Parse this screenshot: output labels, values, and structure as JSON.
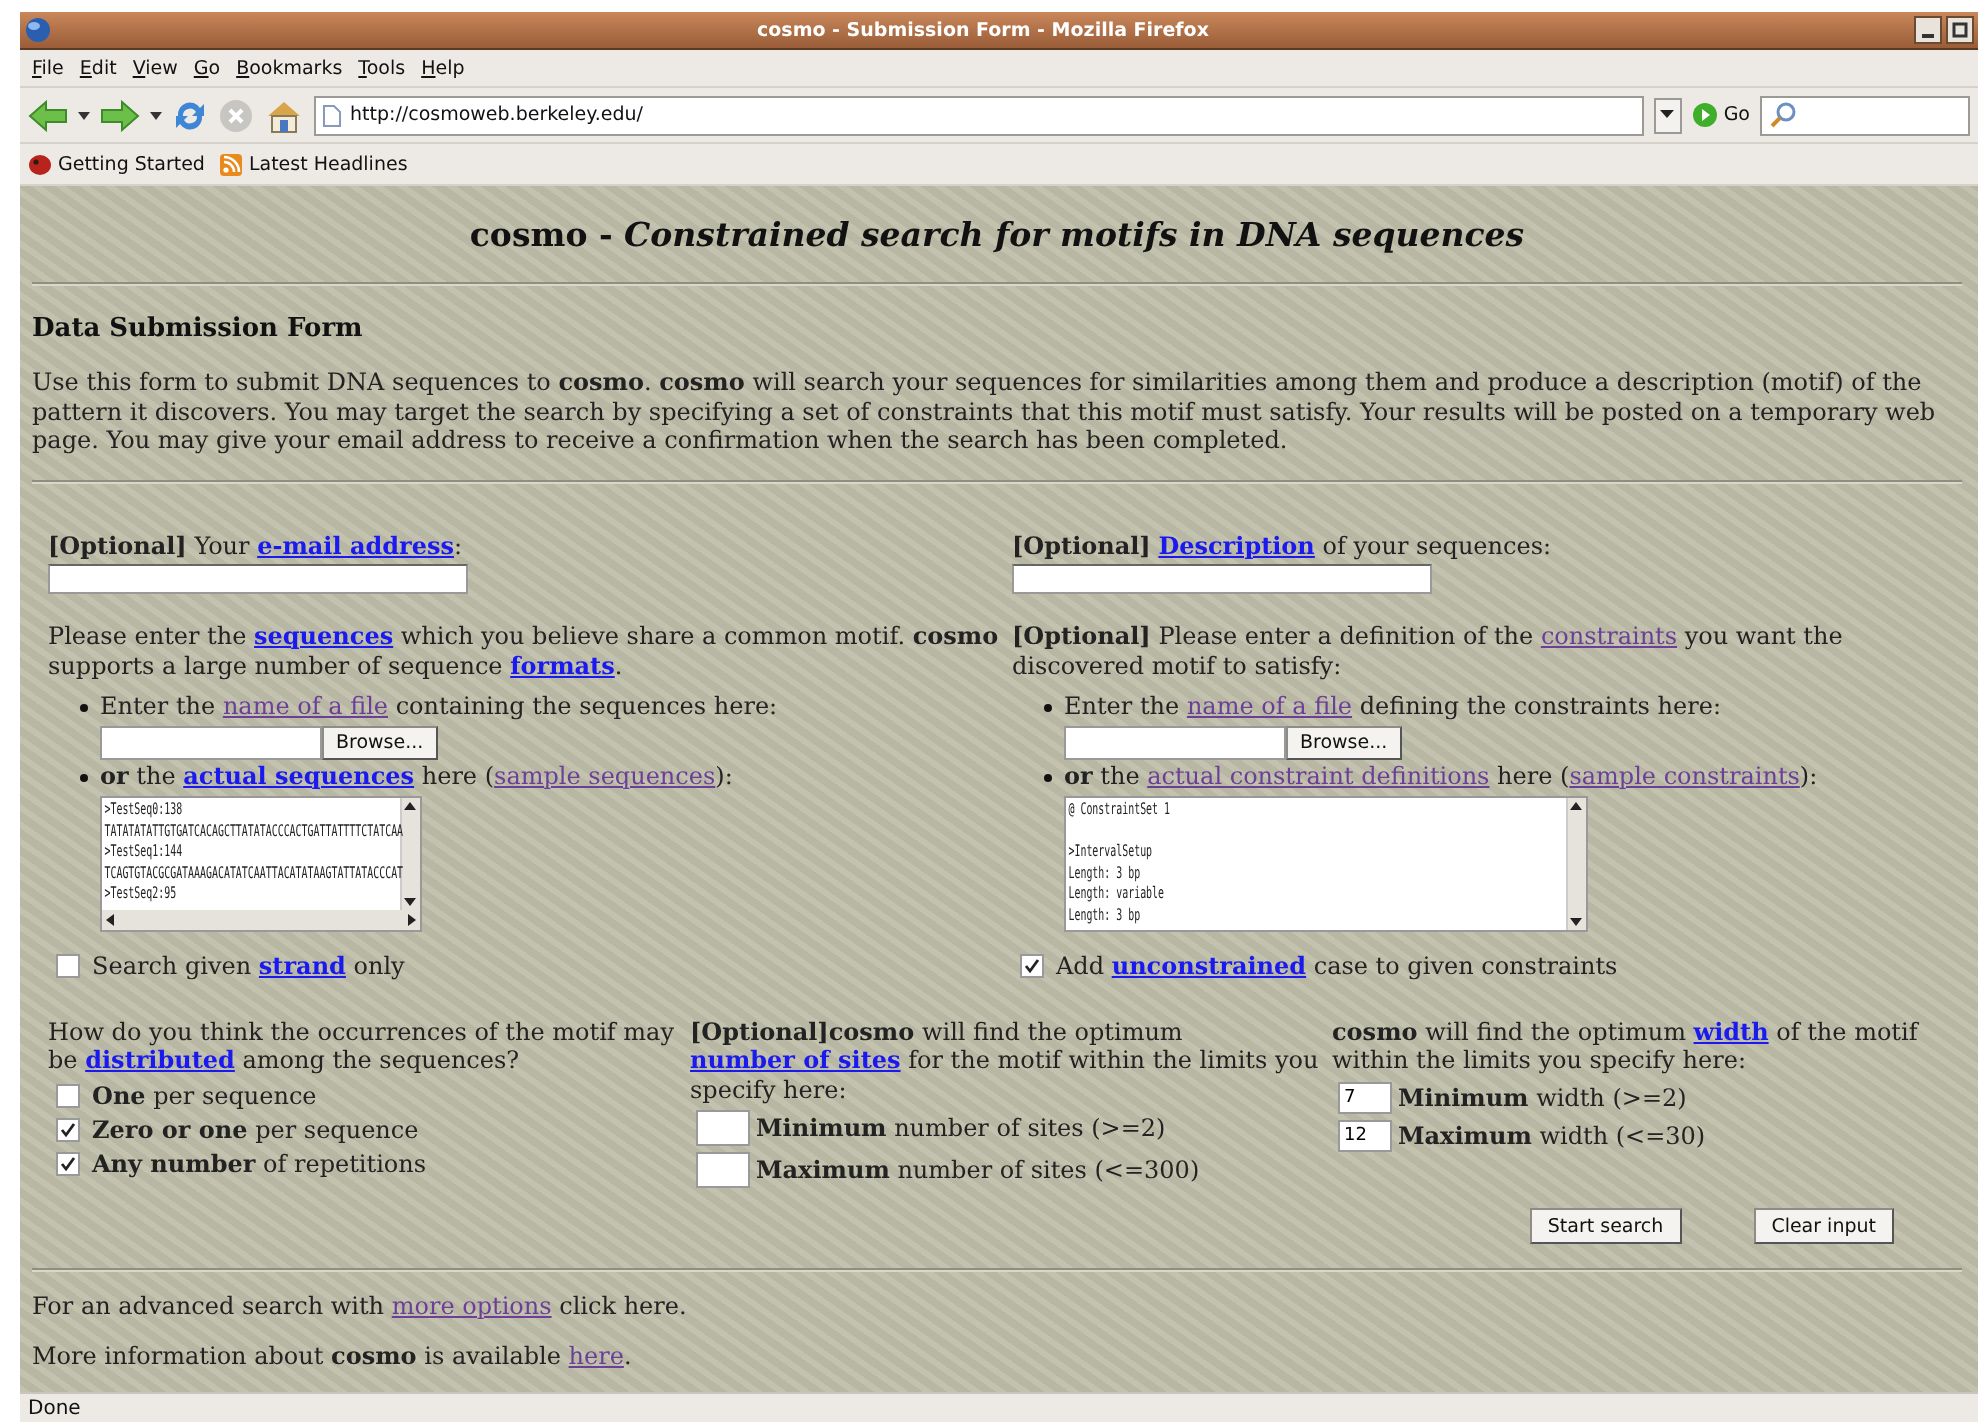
{
  "window": {
    "title": "cosmo - Submission Form - Mozilla Firefox"
  },
  "menu": [
    "File",
    "Edit",
    "View",
    "Go",
    "Bookmarks",
    "Tools",
    "Help"
  ],
  "address_bar": {
    "url": "http://cosmoweb.berkeley.edu/",
    "go": "Go"
  },
  "bookmarks": [
    {
      "label": "Getting Started",
      "kind": "page"
    },
    {
      "label": "Latest Headlines",
      "kind": "feed"
    }
  ],
  "page": {
    "heading": "cosmo - *Constrained search for motifs in DNA sequences*",
    "form_title": "Data Submission Form",
    "intro": "Use this form to submit DNA sequences to **cosmo**. **cosmo** will search your sequences for similarities among them and produce a description (motif) of the pattern it discovers. You may target the search by specifying a set of constraints that this motif must satisfy. Your results will be posted on a temporary web page. You may give your email address to receive a confirmation when the search has been completed.",
    "email": {
      "label": [
        {
          "kind": "text",
          "text": "**[Optional]** Your "
        },
        {
          "kind": "link",
          "text": "e-mail address",
          "visited": false
        },
        {
          "kind": "text",
          "text": ":"
        }
      ]
    },
    "description": {
      "label": [
        {
          "kind": "text",
          "text": "**[Optional]** "
        },
        {
          "kind": "link",
          "text": "Description",
          "visited": false
        },
        {
          "kind": "text",
          "text": " of your sequences:"
        }
      ]
    },
    "sequences": {
      "prompt": [
        {
          "kind": "text",
          "text": "Please enter the "
        },
        {
          "kind": "link",
          "text": "sequences",
          "visited": false
        },
        {
          "kind": "text",
          "text": " which you believe share a common motif. **cosmo** supports a large number of sequence "
        },
        {
          "kind": "link",
          "text": "formats",
          "visited": false
        },
        {
          "kind": "text",
          "text": "."
        }
      ],
      "file": {
        "label": [
          {
            "kind": "text",
            "text": "Enter the "
          },
          {
            "kind": "link",
            "text": "name of a file",
            "visited": true
          },
          {
            "kind": "text",
            "text": " containing the sequences here:"
          }
        ],
        "button": "Browse..."
      },
      "paste": {
        "label": [
          {
            "kind": "text",
            "text": "**or** the "
          },
          {
            "kind": "link",
            "text": "actual sequences",
            "visited": false
          },
          {
            "kind": "text",
            "text": " here ("
          },
          {
            "kind": "link",
            "text": "sample sequences",
            "visited": true
          },
          {
            "kind": "text",
            "text": "):"
          }
        ],
        "blocks": [
          [
            ">TestSeq0:138",
            "TATATATATTGTGATCACAGCTTATATACCCACTGATTATTTTCTATCAA",
            ">TestSeq1:144",
            "TCAGTGTACGCGATAAAGACATATCAATTACATATAAGTATTATACCCAT",
            ">TestSeq2:95"
          ]
        ]
      },
      "option": {
        "label": [
          {
            "kind": "text",
            "text": "Search given "
          },
          {
            "kind": "link",
            "text": "strand",
            "visited": false
          },
          {
            "kind": "text",
            "text": " only"
          }
        ],
        "checked": false
      }
    },
    "constraints": {
      "prompt": [
        {
          "kind": "text",
          "text": "**[Optional]** Please enter a definition of the "
        },
        {
          "kind": "link",
          "text": "constraints",
          "visited": true
        },
        {
          "kind": "text",
          "text": " you want the discovered motif to satisfy:"
        }
      ],
      "file": {
        "label": [
          {
            "kind": "text",
            "text": "Enter the "
          },
          {
            "kind": "link",
            "text": "name of a file",
            "visited": true
          },
          {
            "kind": "text",
            "text": " defining the constraints here:"
          }
        ],
        "button": "Browse..."
      },
      "paste": {
        "label": [
          {
            "kind": "text",
            "text": "**or** the "
          },
          {
            "kind": "link",
            "text": "actual constraint definitions",
            "visited": true
          },
          {
            "kind": "text",
            "text": " here ("
          },
          {
            "kind": "link",
            "text": "sample constraints",
            "visited": true
          },
          {
            "kind": "text",
            "text": "):"
          }
        ],
        "blocks": [
          [
            "@ ConstraintSet 1"
          ],
          [
            ">IntervalSetup",
            "Length: 3 bp",
            "Length: variable",
            "Length: 3 bp"
          ]
        ]
      },
      "option": {
        "label": [
          {
            "kind": "text",
            "text": "Add "
          },
          {
            "kind": "link",
            "text": "unconstrained",
            "visited": false
          },
          {
            "kind": "text",
            "text": " case to given constraints"
          }
        ],
        "checked": true
      }
    },
    "distribution": {
      "question": [
        {
          "kind": "text",
          "text": "How do you think the occurrences of the motif may be "
        },
        {
          "kind": "link",
          "text": "distributed",
          "visited": false
        },
        {
          "kind": "text",
          "text": " among the sequences?"
        }
      ],
      "options": [
        {
          "label": "**One** per sequence",
          "checked": false
        },
        {
          "label": "**Zero or one** per sequence",
          "checked": true
        },
        {
          "label": "**Any number** of repetitions",
          "checked": true
        }
      ]
    },
    "sites": {
      "text": [
        {
          "kind": "text",
          "text": "**[Optional]cosmo** will find the optimum "
        },
        {
          "kind": "link",
          "text": "number of sites",
          "visited": false
        },
        {
          "kind": "text",
          "text": " for the motif within the limits you specify here:"
        }
      ],
      "fields": [
        {
          "label": "**Minimum** number of sites (>=2)"
        },
        {
          "label": "**Maximum** number of sites (<=300)"
        }
      ]
    },
    "width": {
      "text": [
        {
          "kind": "text",
          "text": "**cosmo** will find the optimum "
        },
        {
          "kind": "link",
          "text": "width",
          "visited": false
        },
        {
          "kind": "text",
          "text": " of the motif within the limits you specify here:"
        }
      ],
      "fields": [
        {
          "label": "**Minimum** width (>=2)",
          "value": "7"
        },
        {
          "label": "**Maximum** width (<=30)",
          "value": "12"
        }
      ]
    },
    "actions": [
      "Start search",
      "Clear input"
    ],
    "footer": [
      [
        {
          "kind": "text",
          "text": "For an advanced search with "
        },
        {
          "kind": "link",
          "text": "more options",
          "visited": true
        },
        {
          "kind": "text",
          "text": " click here."
        }
      ],
      [
        {
          "kind": "text",
          "text": "More information about **cosmo** is available "
        },
        {
          "kind": "link",
          "text": "here",
          "visited": true
        },
        {
          "kind": "text",
          "text": "."
        }
      ]
    ]
  },
  "status_bar": {
    "text": "Done"
  }
}
